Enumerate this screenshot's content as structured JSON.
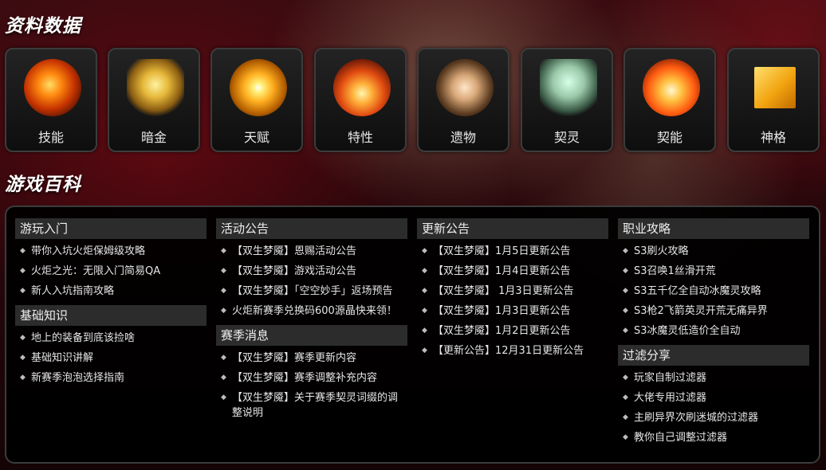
{
  "sections": {
    "data_title": "资料数据",
    "wiki_title": "游戏百科"
  },
  "cards": [
    {
      "label": "技能",
      "icon": "flaming-sword-icon"
    },
    {
      "label": "暗金",
      "icon": "golden-armor-icon"
    },
    {
      "label": "天赋",
      "icon": "radiant-orb-icon"
    },
    {
      "label": "特性",
      "icon": "flame-burst-icon"
    },
    {
      "label": "遗物",
      "icon": "figure-relic-icon"
    },
    {
      "label": "契灵",
      "icon": "spirit-creature-icon"
    },
    {
      "label": "契能",
      "icon": "fire-crown-icon"
    },
    {
      "label": "神格",
      "icon": "golden-block-icon"
    }
  ],
  "columns": [
    {
      "groups": [
        {
          "heading": "游玩入门",
          "items": [
            "带你入坑火炬保姆级攻略",
            "火炬之光：无限入门简易QA",
            "新人入坑指南攻略"
          ]
        },
        {
          "heading": "基础知识",
          "items": [
            "地上的装备到底该捡啥",
            "基础知识讲解",
            "新赛季泡泡选择指南"
          ]
        }
      ]
    },
    {
      "groups": [
        {
          "heading": "活动公告",
          "items": [
            "【双生梦魇】恩赐活动公告",
            "【双生梦魇】游戏活动公告",
            "【双生梦魇】「空空妙手」返场预告",
            "火炬新赛季兑换码600源晶快来领！"
          ]
        },
        {
          "heading": "赛季消息",
          "items": [
            "【双生梦魇】赛季更新内容",
            "【双生梦魇】赛季调整补充内容",
            "【双生梦魇】关于赛季契灵词缀的调整说明"
          ]
        }
      ]
    },
    {
      "groups": [
        {
          "heading": "更新公告",
          "items": [
            "【双生梦魇】1月5日更新公告",
            "【双生梦魇】1月4日更新公告",
            "【双生梦魇】 1月3日更新公告",
            "【双生梦魇】1月3日更新公告",
            "【双生梦魇】1月2日更新公告",
            "【更新公告】12月31日更新公告"
          ]
        }
      ]
    },
    {
      "groups": [
        {
          "heading": "职业攻略",
          "items": [
            "S3刷火攻略",
            "S3召唤1丝滑开荒",
            "S3五千亿全自动冰魔灵攻略",
            "S3枪2飞箭英灵开荒无痛异界",
            "S3冰魔灵低造价全自动"
          ]
        },
        {
          "heading": "过滤分享",
          "items": [
            "玩家自制过滤器",
            "大佬专用过滤器",
            "主刷异界次刷迷城的过滤器",
            "教你自己调整过滤器"
          ]
        }
      ]
    }
  ]
}
